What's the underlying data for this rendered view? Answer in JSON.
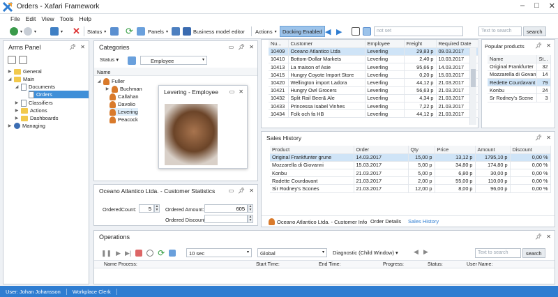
{
  "window": {
    "title": "Orders - Xafari Framework"
  },
  "menu": [
    "File",
    "Edit",
    "View",
    "Tools",
    "Help"
  ],
  "toolbar": {
    "status_label": "Status",
    "panels_label": "Panels",
    "business_model_label": "Business model editor",
    "actions_label": "Actions",
    "docking_label": "Docking Enabled",
    "filter_placeholder": "not set",
    "search_placeholder": "Text to search",
    "search_button": "search"
  },
  "arms_panel": {
    "title": "Arms Panel",
    "items": [
      {
        "label": "General"
      },
      {
        "label": "Main"
      },
      {
        "label": "Documents"
      },
      {
        "label": "Orders"
      },
      {
        "label": "Classifiers"
      },
      {
        "label": "Actions"
      },
      {
        "label": "Dashboards"
      },
      {
        "label": "Managing"
      }
    ]
  },
  "categories": {
    "title": "Categories",
    "status_label": "Status",
    "select_value": "Employee",
    "column": "Name",
    "root": "Fuller",
    "children": [
      "Buchman",
      "Callahan",
      "Davolio",
      "Levering",
      "Peacock"
    ]
  },
  "popup": {
    "title": "Levering - Employee"
  },
  "customer_stats": {
    "title": "Oceano Atlantico Ltda. - Customer Statistics",
    "ordered_count_label": "OrderedCount:",
    "ordered_count": "5",
    "ordered_amount_label": "Ordered Amount:",
    "ordered_amount": "605",
    "ordered_discount_label": "Ordered Discount:",
    "ordered_discount": ""
  },
  "orders": {
    "columns": [
      "Nu...",
      "Customer",
      "Employee",
      "Freight",
      "Required Date"
    ],
    "rows": [
      [
        "10409",
        "Oceano Atlantico Ltda",
        "Leverling",
        "29,83 p",
        "09.03.2017"
      ],
      [
        "10410",
        "Bottom-Dollar Markets",
        "Leverling",
        "2,40 p",
        "10.03.2017"
      ],
      [
        "10413",
        "La maison of Asie",
        "Leverling",
        "95,66 p",
        "14.03.2017"
      ],
      [
        "10415",
        "Hungry Coyote Import Store",
        "Leverling",
        "0,20 p",
        "15.03.2017"
      ],
      [
        "10420",
        "Wellington import Ladora",
        "Leverling",
        "44,12 p",
        "21.03.2017"
      ],
      [
        "10421",
        "Hungry Owl Grocers",
        "Leverling",
        "56,63 p",
        "21.03.2017"
      ],
      [
        "10432",
        "Split Rail Beer& Ale",
        "Leverling",
        "4,34 p",
        "21.03.2017"
      ],
      [
        "10433",
        "Princessa Isabel Vinhes",
        "Leverling",
        "7,22 p",
        "21.03.2017"
      ],
      [
        "10434",
        "Folk och fa HB",
        "Leverling",
        "44,12 p",
        "21.03.2017"
      ]
    ]
  },
  "popular": {
    "title": "Popular products",
    "columns": [
      "Name",
      "St..."
    ],
    "rows": [
      [
        "Original Frankfurter",
        "32"
      ],
      [
        "Mozzarella di Govani",
        "14"
      ],
      [
        "Redette Courdavant",
        "79"
      ],
      [
        "Konbu",
        "24"
      ],
      [
        "Sr Rodney's Scene",
        "3"
      ]
    ]
  },
  "sales": {
    "title": "Sales History",
    "columns": [
      "Product",
      "Order",
      "Qty",
      "Price",
      "Amount",
      "Discount"
    ],
    "rows": [
      [
        "Original Frankfunter grune",
        "14.03.2017",
        "15,00 p",
        "13,12 p",
        "1795,10 p",
        "0,00 %"
      ],
      [
        "Mozzarella di Giovanni",
        "15.03.2017",
        "5,00 p",
        "34,80 p",
        "174,80 p",
        "0,00 %"
      ],
      [
        "Konbu",
        "21.03.2017",
        "5,00 p",
        "6,80 p",
        "30,00 p",
        "0,00 %"
      ],
      [
        "Radette Courdavant",
        "21.03.2017",
        "2,00 p",
        "55,00 p",
        "110,00 p",
        "0,00 %"
      ],
      [
        "Sir Rodney's Scones",
        "21.03.2017",
        "12,00 p",
        "8,00 p",
        "96,00 p",
        "0,00 %"
      ]
    ],
    "tabs": [
      "Oceano Atlantico Ltda. - Customer Info",
      "Order Details",
      "Sales History"
    ]
  },
  "operations": {
    "title": "Operations",
    "interval": "10 sec",
    "scope": "Global",
    "diagnostic": "Diagnostic   (Child Window)",
    "search_placeholder": "Text to search",
    "search_button": "search",
    "columns": [
      "Name Process:",
      "Start Time:",
      "End Time:",
      "Progress:",
      "Status:",
      "User Name:"
    ]
  },
  "statusbar": {
    "user": "User: Johan Johansson",
    "role": "Workplace Clerk"
  },
  "colors": {
    "accent": "#3f8fd8",
    "statusbar": "#2f7dd1",
    "highlight": "#cfe4f7"
  }
}
